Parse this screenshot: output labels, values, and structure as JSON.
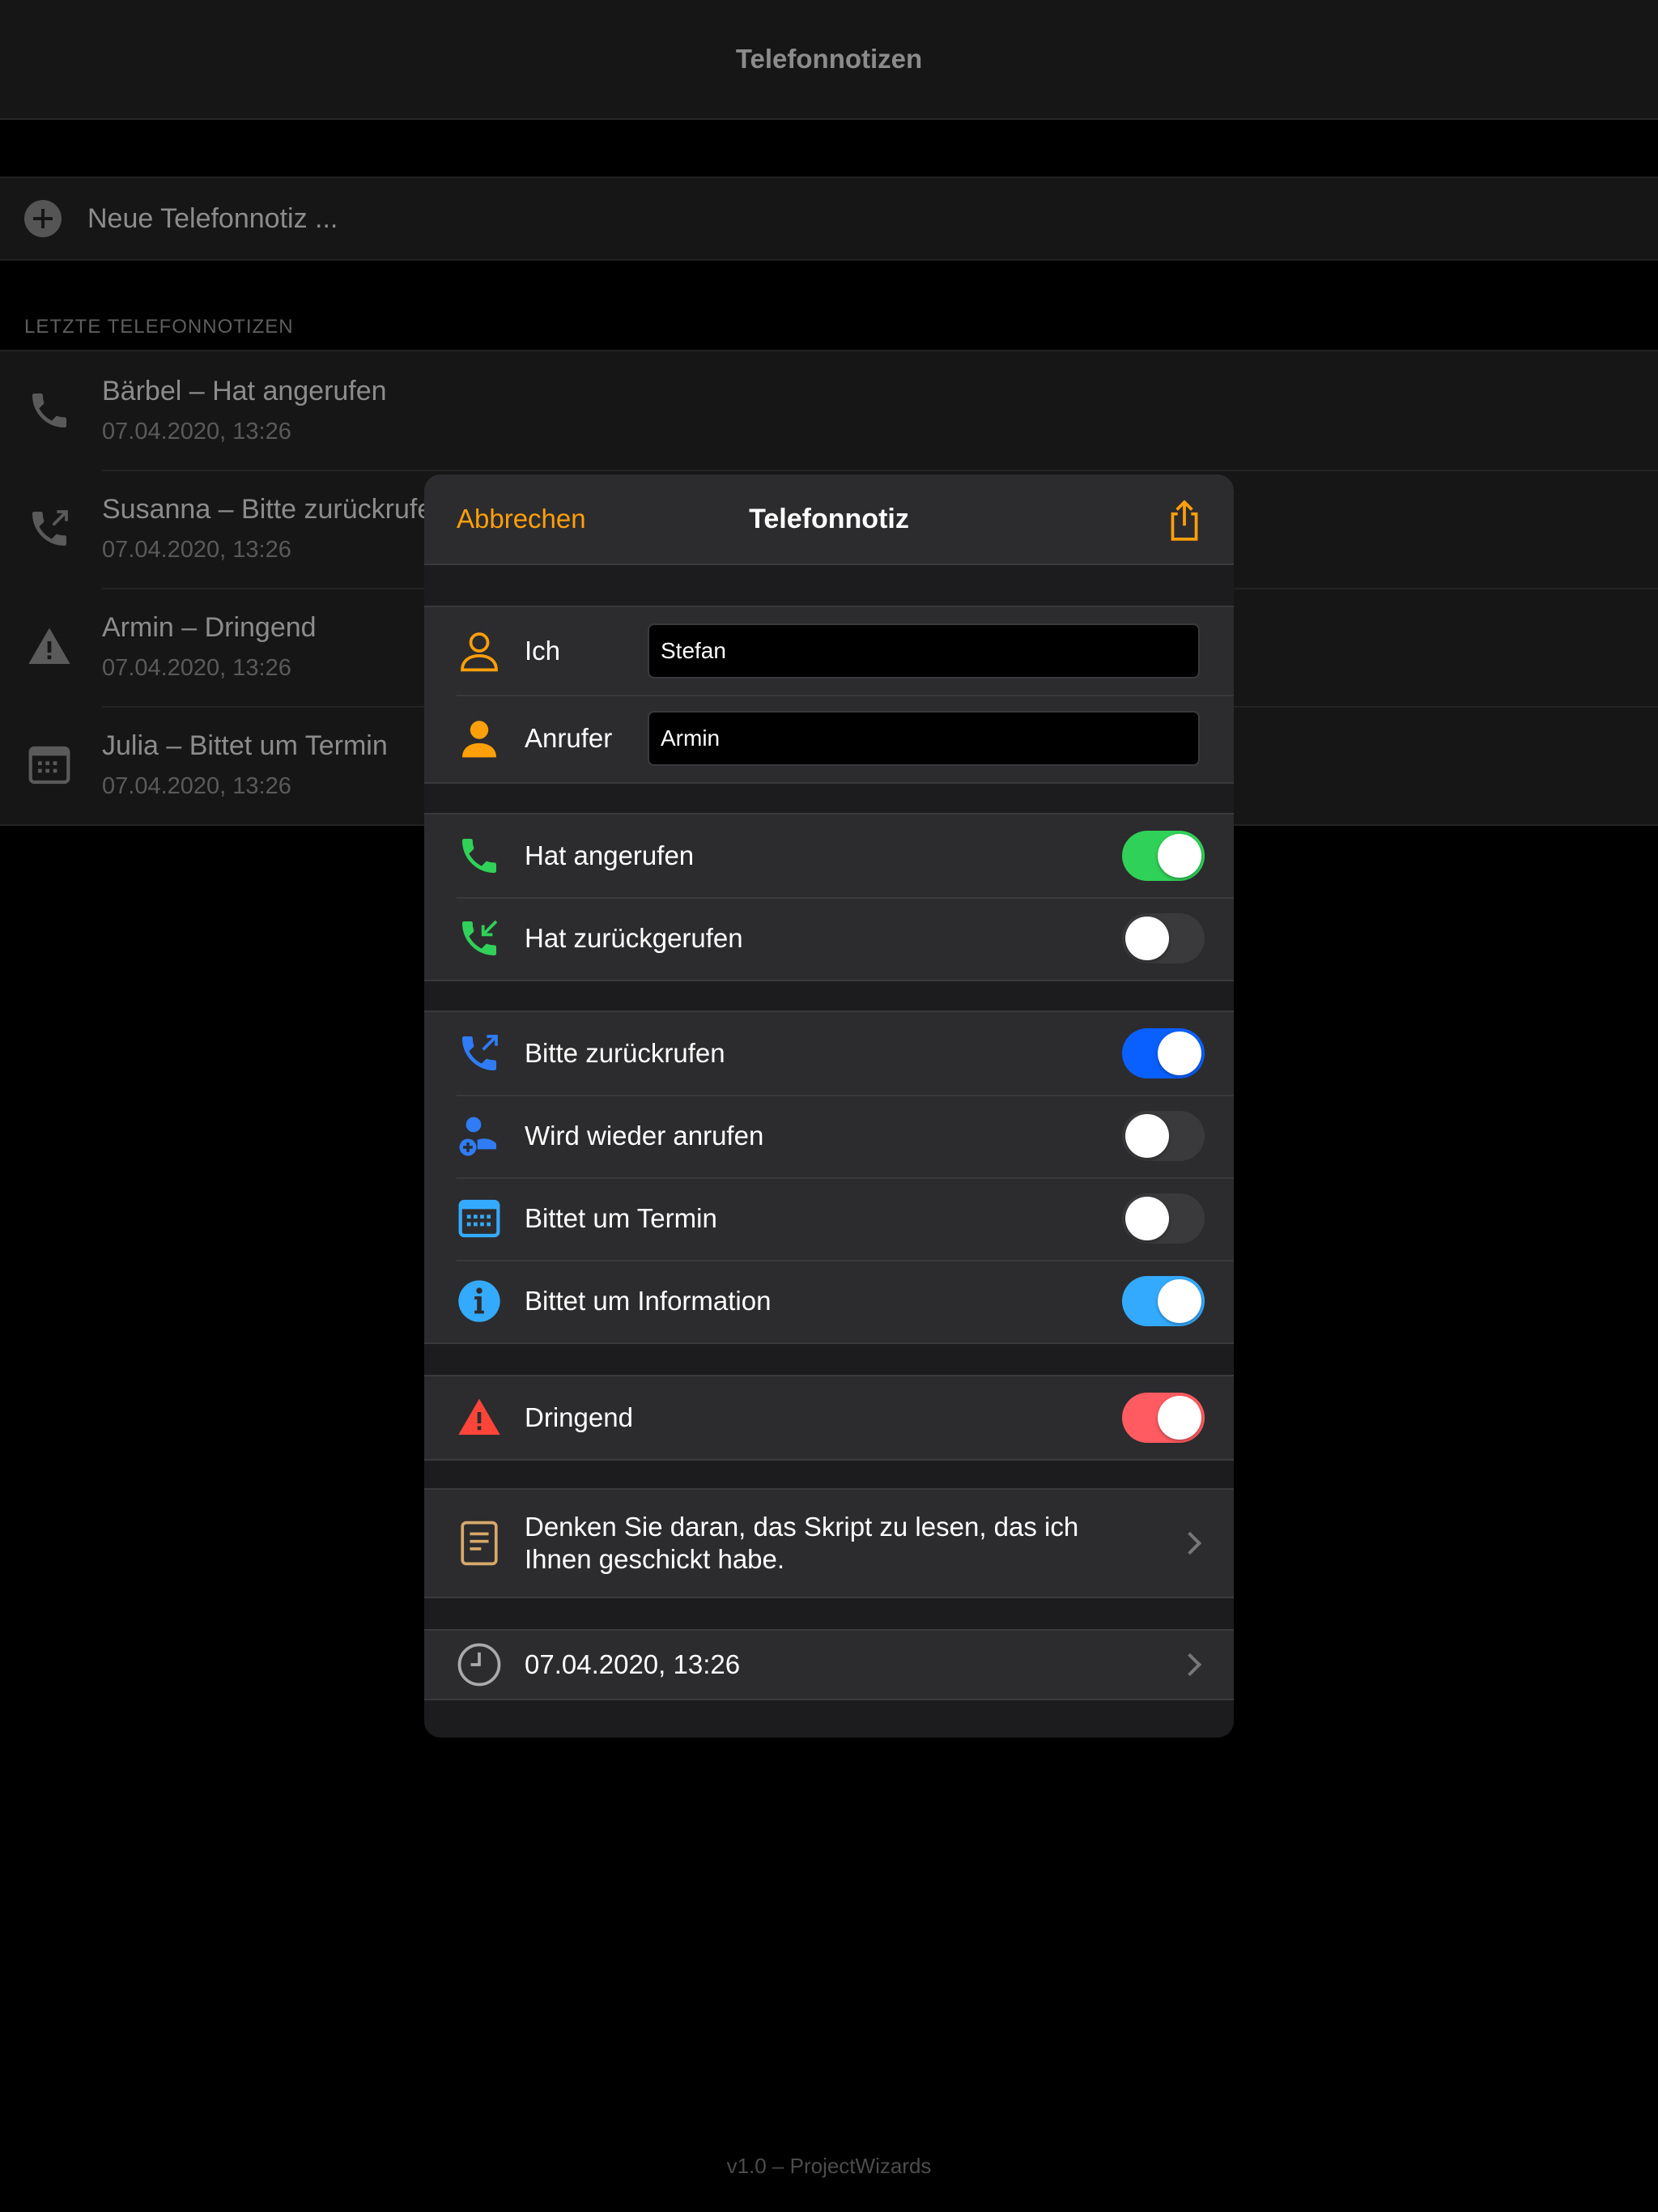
{
  "background": {
    "nav_title": "Telefonnotizen",
    "new_note_label": "Neue Telefonnotiz ...",
    "section_header": "LETZTE TELEFONNOTIZEN",
    "items": [
      {
        "title": "Bärbel – Hat angerufen",
        "date": "07.04.2020, 13:26",
        "icon": "phone-icon"
      },
      {
        "title": "Susanna – Bitte zurückrufen",
        "date": "07.04.2020, 13:26",
        "icon": "phone-outgoing-icon"
      },
      {
        "title": "Armin – Dringend",
        "date": "07.04.2020, 13:26",
        "icon": "warning-icon"
      },
      {
        "title": "Julia – Bittet um Termin",
        "date": "07.04.2020, 13:26",
        "icon": "calendar-icon"
      }
    ],
    "footer": "v1.0 – ProjectWizards"
  },
  "modal": {
    "cancel_label": "Abbrechen",
    "title": "Telefonnotiz",
    "people": [
      {
        "label": "Ich",
        "value": "Stefan",
        "icon": "person-outline-icon"
      },
      {
        "label": "Anrufer",
        "value": "Armin",
        "icon": "person-filled-icon"
      }
    ],
    "call_status": [
      {
        "label": "Hat angerufen",
        "on": true,
        "color": "#30d158",
        "icon": "phone-icon"
      },
      {
        "label": "Hat zurückgerufen",
        "on": false,
        "color": "#30d158",
        "icon": "phone-incoming-icon"
      }
    ],
    "requests": [
      {
        "label": "Bitte zurückrufen",
        "on": true,
        "color": "#0a60ff",
        "icon": "phone-outgoing-icon"
      },
      {
        "label": "Wird wieder anrufen",
        "on": false,
        "color": "#0a60ff",
        "icon": "person-plus-icon"
      },
      {
        "label": "Bittet um Termin",
        "on": false,
        "color": "#0a60ff",
        "icon": "calendar-icon"
      },
      {
        "label": "Bittet um Information",
        "on": true,
        "color": "#34aaff",
        "icon": "info-icon"
      }
    ],
    "urgent": {
      "label": "Dringend",
      "on": true,
      "color": "#ff453a",
      "icon": "warning-icon"
    },
    "note": {
      "text": "Denken Sie daran, das Skript zu lesen, das ich Ihnen geschickt habe.",
      "icon": "document-icon"
    },
    "datetime": {
      "text": "07.04.2020, 13:26",
      "icon": "clock-icon"
    }
  },
  "colors": {
    "accent": "#ff9f0a",
    "toggle_off": "#3a3a3c",
    "green": "#30d158",
    "blue": "#0a60ff",
    "light_blue": "#34aaff",
    "red": "#ff453a"
  }
}
